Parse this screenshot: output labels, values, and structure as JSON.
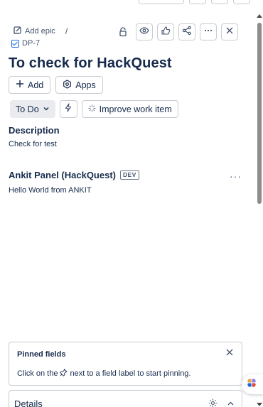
{
  "breadcrumb": {
    "add_epic_label": "Add epic",
    "separator": "/",
    "issue_key": "DP-7"
  },
  "toolbar": {
    "icons": [
      "lock-icon",
      "eye-icon",
      "thumbs-up-icon",
      "share-icon",
      "more-icon",
      "close-icon"
    ]
  },
  "work_item": {
    "title": "To check for HackQuest"
  },
  "actions": {
    "add_label": "Add",
    "apps_label": "Apps"
  },
  "status": {
    "current": "To Do",
    "improve_label": "Improve work item"
  },
  "description": {
    "heading": "Description",
    "text": "Check for test"
  },
  "app_panel": {
    "title": "Ankit Panel (HackQuest)",
    "badge": "DEV",
    "more": "···",
    "text": "Hello World from ANKIT"
  },
  "pinned_fields": {
    "title": "Pinned fields",
    "hint_before": "Click on the",
    "hint_after": "next to a field label to start pinning."
  },
  "details": {
    "title": "Details"
  },
  "colors": {
    "accent": "#1868db",
    "text": "#172b4d",
    "subtle": "#44546f",
    "border": "#c8ccd3"
  }
}
